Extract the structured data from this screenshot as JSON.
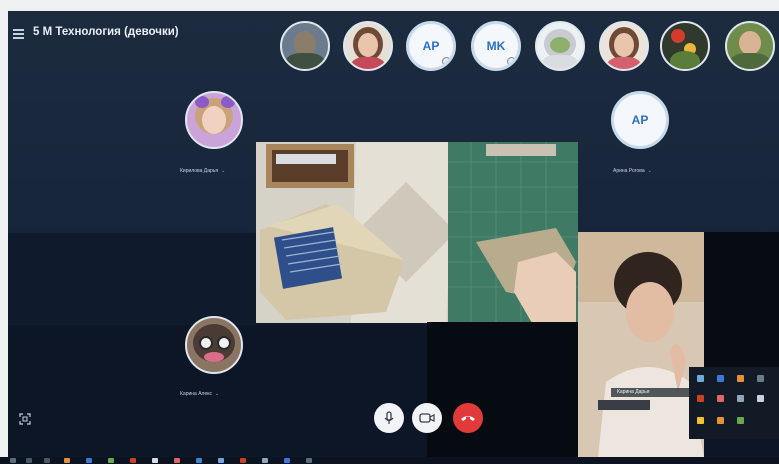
{
  "window": {
    "title": "5 М Технология (девочки)"
  },
  "header_avatars": [
    {
      "kind": "photo",
      "name_icon": "participant-photo"
    },
    {
      "kind": "photo",
      "name_icon": "participant-photo"
    },
    {
      "kind": "initials",
      "initials": "AP"
    },
    {
      "kind": "initials",
      "initials": "MK"
    },
    {
      "kind": "photo",
      "name_icon": "participant-photo"
    },
    {
      "kind": "photo",
      "name_icon": "participant-photo"
    },
    {
      "kind": "photo",
      "name_icon": "participant-photo"
    },
    {
      "kind": "photo",
      "name_icon": "participant-photo"
    }
  ],
  "participants": {
    "left_top": {
      "name": "Кирилова Дарья"
    },
    "right_top": {
      "initials": "AP",
      "name": "Арина Рогова"
    },
    "left_bottom": {
      "name": "Карина Алекс"
    },
    "self_view": {
      "name": "Карина Дарья"
    }
  },
  "controls": {
    "mic_icon": "microphone-icon",
    "camera_icon": "camera-icon",
    "end_call_icon": "end-call-icon",
    "end_call_color": "#e03a3a"
  },
  "colors": {
    "background": "#16243a",
    "accent": "#2a6fc9"
  }
}
